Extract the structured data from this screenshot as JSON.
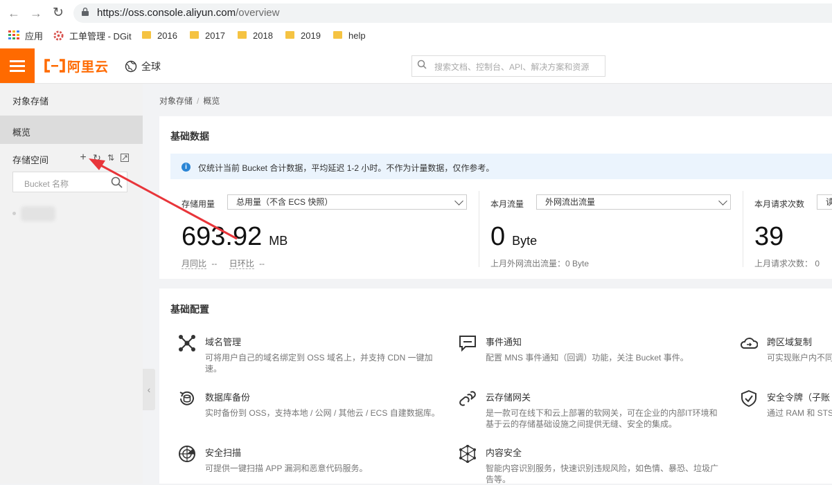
{
  "browser": {
    "url_main": "https://oss.console.aliyun.com",
    "url_path": "/overview",
    "bookmarks": [
      {
        "label": "应用",
        "icon": "apps-grid-icon"
      },
      {
        "label": "工单管理 - DGit",
        "icon": "gear-red-icon"
      },
      {
        "label": "2016",
        "icon": "folder-icon"
      },
      {
        "label": "2017",
        "icon": "folder-icon"
      },
      {
        "label": "2018",
        "icon": "folder-icon"
      },
      {
        "label": "2019",
        "icon": "folder-icon"
      },
      {
        "label": "help",
        "icon": "folder-icon"
      }
    ]
  },
  "topbar": {
    "logo_text": "阿里云",
    "region": "全球",
    "search_placeholder": "搜索文档、控制台、API、解决方案和资源"
  },
  "sidebar": {
    "title": "对象存储",
    "overview": "概览",
    "buckets_label": "存储空间",
    "bucket_search_placeholder": "Bucket 名称"
  },
  "breadcrumb": {
    "root": "对象存储",
    "separator": "/",
    "current": "概览"
  },
  "basic_data": {
    "title": "基础数据",
    "notice": "仅统计当前 Bucket 合计数据，平均延迟 1-2 小时。不作为计量数据，仅作参考。",
    "storage": {
      "label": "存储用量",
      "select": "总用量（不含 ECS 快照）",
      "value": "693.92",
      "unit": "MB",
      "mom_label": "月同比",
      "mom_value": "--",
      "dod_label": "日环比",
      "dod_value": "--"
    },
    "traffic": {
      "label": "本月流量",
      "select": "外网流出流量",
      "value": "0",
      "unit": "Byte",
      "prev": "上月外网流出流量：0 Byte"
    },
    "requests": {
      "label": "本月请求次数",
      "select": "读",
      "value": "39",
      "prev": "上月请求次数：  0"
    }
  },
  "basic_config": {
    "title": "基础配置",
    "items": [
      {
        "title": "域名管理",
        "desc": "可将用户自己的域名绑定到 OSS 域名上，并支持 CDN 一键加速。",
        "icon": "network-nodes-icon"
      },
      {
        "title": "事件通知",
        "desc": "配置 MNS 事件通知（回调）功能，关注 Bucket 事件。",
        "icon": "message-icon"
      },
      {
        "title": "跨区域复制",
        "desc": "可实现账户内不同",
        "icon": "cloud-sync-icon"
      },
      {
        "title": "数据库备份",
        "desc": "实时备份到 OSS，支持本地 / 公网 / 其他云 / ECS 自建数据库。",
        "icon": "database-backup-icon"
      },
      {
        "title": "云存储网关",
        "desc": "是一款可在线下和云上部署的软网关，可在企业的内部IT环境和基于云的存储基础设施之间提供无缝、安全的集成。",
        "icon": "gateway-link-icon"
      },
      {
        "title": "安全令牌（子账",
        "desc": "通过 RAM 和 STS",
        "icon": "shield-check-icon"
      },
      {
        "title": "安全扫描",
        "desc": "可提供一键扫描 APP 漏洞和恶意代码服务。",
        "icon": "radar-scan-icon"
      },
      {
        "title": "内容安全",
        "desc": "智能内容识别服务，快速识别违规风险，如色情、暴恐、垃圾广告等。",
        "icon": "content-security-icon"
      }
    ]
  },
  "colors": {
    "brand": "#ff6a00",
    "notice_bg": "#ebf4fd",
    "info": "#2a85d5",
    "annotation_arrow": "#e8353a"
  }
}
